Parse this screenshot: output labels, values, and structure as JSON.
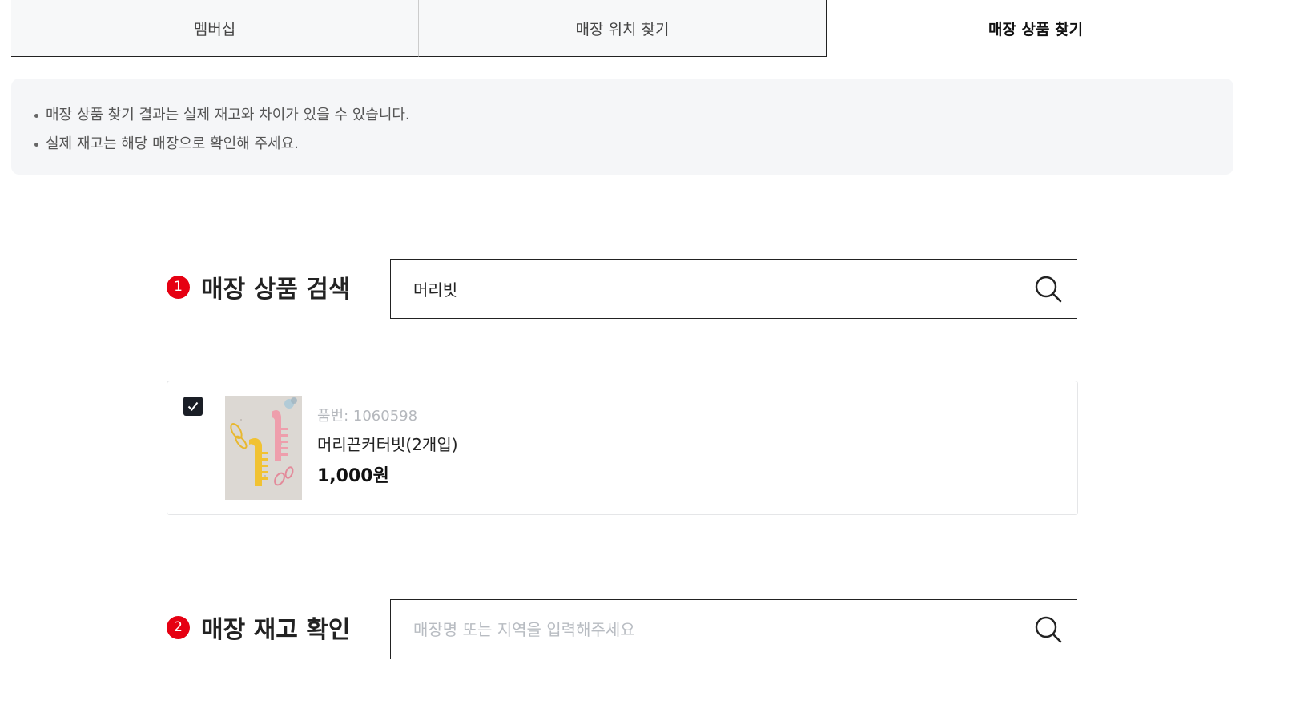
{
  "tabs": [
    {
      "label": "멤버십",
      "active": false
    },
    {
      "label": "매장 위치 찾기",
      "active": false
    },
    {
      "label": "매장 상품 찾기",
      "active": true
    }
  ],
  "notice": {
    "lines": [
      "매장 상품 찾기 결과는 실제 재고와 차이가 있을 수 있습니다.",
      "실제 재고는 해당 매장으로 확인해 주세요."
    ]
  },
  "step1": {
    "number": "1",
    "title": "매장 상품 검색",
    "search_value": "머리빗",
    "search_placeholder": "",
    "search_icon": "search-icon"
  },
  "product": {
    "checked": true,
    "code": "품번: 1060598",
    "name": "머리끈커터빗(2개입)",
    "price": "1,000원"
  },
  "step2": {
    "number": "2",
    "title": "매장 재고 확인",
    "search_value": "",
    "search_placeholder": "매장명 또는 지역을 입력해주세요",
    "search_icon": "search-icon"
  },
  "colors": {
    "accent": "#e60012",
    "checkbox": "#1a1e26",
    "notice_bg": "#f5f6f8"
  }
}
